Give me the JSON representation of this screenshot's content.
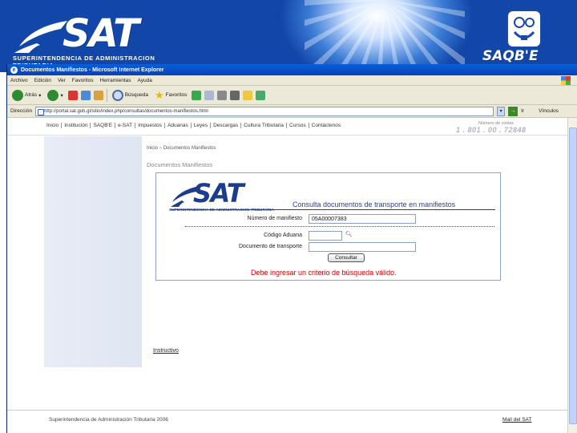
{
  "window": {
    "title": "Documentos Manifiestos - Microsoft Internet Explorer"
  },
  "banner": {
    "logo_text": "SAT",
    "subtitle": "SUPERINTENDENCIA DE ADMINISTRACION TRIBUTARIA",
    "saqbe_text": "SAQB'E"
  },
  "menu": [
    "Archivo",
    "Edición",
    "Ver",
    "Favoritos",
    "Herramientas",
    "Ayuda"
  ],
  "toolbar": {
    "back_label": "Atrás",
    "search_label": "Búsqueda",
    "favorites_label": "Favoritos"
  },
  "address": {
    "label": "Dirección",
    "url": "http://portal.sat.gob.gt/sitio/index.php/consultas/documentos-manifiestos.html",
    "go_label": "Ir",
    "links_label": "Vínculos"
  },
  "nav": {
    "items": [
      "Inicio",
      "Institución",
      "SAQB'E",
      "e-SAT",
      "Impuestos",
      "Aduanas",
      "Leyes",
      "Descargas",
      "Cultura Tributaria",
      "Cursos",
      "Contáctenos"
    ],
    "counter_label": "Número de visitas",
    "counter": "1 . 801 . 00 . 72848"
  },
  "breadcrumb": {
    "home": "Inicio",
    "separator": "»",
    "current": "Documentos Manifiestos"
  },
  "section_title": "Documentos Manifiestos",
  "form": {
    "logo_text": "SAT",
    "logo_subtitle": "SUPERINTENDENCIA DE ADMINISTRACION TRIBUTARIA",
    "title": "Consulta documentos de transporte en manifiestos",
    "manifest_label": "Número de manifiesto",
    "manifest_value": "05A00007383",
    "code_label": "Código Aduana",
    "code_value": "",
    "transport_label": "Documento de transporte",
    "transport_value": "",
    "submit_label": "Consultar",
    "error": "Debe ingresar un criterio de búsqueda válido."
  },
  "instructions_link": "Instructivo",
  "footer": {
    "copyright": "Superintendencia de Administración Tributaria 2006",
    "link": "Mail del SAT"
  }
}
